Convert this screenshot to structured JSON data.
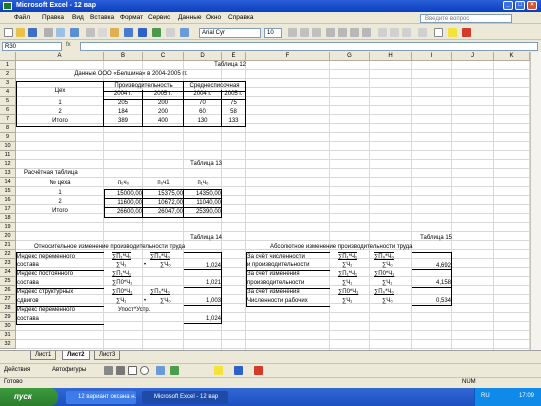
{
  "window": {
    "title": "Microsoft Excel - 12 вар"
  },
  "menu": [
    "Файл",
    "Правка",
    "Вид",
    "Вставка",
    "Формат",
    "Сервис",
    "Данные",
    "Окно",
    "Справка"
  ],
  "help_placeholder": "Введите вопрос",
  "toolbar": {
    "font": "Arial Cyr",
    "size": "10"
  },
  "namebox": "R30",
  "fx": "fx",
  "columns": [
    "A",
    "B",
    "C",
    "D",
    "E",
    "F",
    "G",
    "H",
    "I",
    "J",
    "K"
  ],
  "rows": [
    "1",
    "2",
    "3",
    "4",
    "5",
    "6",
    "7",
    "8",
    "9",
    "10",
    "11",
    "12",
    "13",
    "14",
    "15",
    "16",
    "17",
    "18",
    "19",
    "20",
    "21",
    "22",
    "23",
    "24",
    "25",
    "26",
    "27",
    "28",
    "29",
    "30",
    "31",
    "32"
  ],
  "t12": {
    "label": "Таблица 12",
    "title": "Данные ООО «Белшина» в 2004-2005 гг.",
    "h_shop": "Цех",
    "h_prod": "Производительность",
    "h_avg": "Среднесписочная",
    "y2004": "2004 г.",
    "y2005": "2005 г.",
    "rows": [
      {
        "n": "1",
        "a": "205",
        "b": "200",
        "c": "70",
        "d": "75"
      },
      {
        "n": "2",
        "a": "184",
        "b": "200",
        "c": "60",
        "d": "58"
      },
      {
        "n": "Итого",
        "a": "389",
        "b": "400",
        "c": "130",
        "d": "133"
      }
    ]
  },
  "t13": {
    "label": "Таблица 13",
    "title": "Расчётная таблица",
    "h_shop": "№ цеха",
    "h1": "п₀ч₀",
    "h2": "п₀ч1",
    "h3": "п₁ч₀",
    "rows": [
      {
        "n": "1",
        "a": "15000,00",
        "b": "15375,00",
        "c": "14350,00"
      },
      {
        "n": "2",
        "a": "11600,00",
        "b": "10672,00",
        "c": "11040,00"
      },
      {
        "n": "Итого",
        "a": "26600,00",
        "b": "26047,00",
        "c": "25390,00"
      }
    ]
  },
  "t14": {
    "label": "Таблица 14",
    "title": "Относительное изменение производительности труда",
    "r1a": "Индекс переменного",
    "r1b": "состава",
    "r1f1": "∑П₁*Ч₁",
    "r1f2": "∑П₀*Ч₀",
    "r1f3": "∑Ч₁",
    "r1f4": "∑Ч₀",
    "r1v": "1,024",
    "r2a": "Индекс постоянного",
    "r2b": "состава",
    "r2f1": "∑П₁*Ч₁",
    "r2f2": "∑П0*Ч₁",
    "r2v": "1,021",
    "r3a": "Индекс структурных",
    "r3b": "сдвигов",
    "r3f1": "∑П0*Ч₁",
    "r3f2": "∑П₀*Ч₀",
    "r3f3": "∑Ч₁",
    "r3f4": "∑Ч₀",
    "r3v": "1,003",
    "r4a": "Индекс переменного",
    "r4b": "состава",
    "r4f": "Упост*Устр.",
    "r4v": "1,024",
    "bullet": "•"
  },
  "t15": {
    "label": "Таблица 15",
    "title": "Абсолютное изменение производительности труда",
    "r1a": "За счёт численности",
    "r1b": "и производительности",
    "r1f1": "∑П₁*Ч₁",
    "r1f2": "∑П₀*Ч₀",
    "r1f3": "∑Ч₁",
    "r1f4": "∑Ч₀",
    "r1v": "4,692",
    "r2a": "За счёт изменения",
    "r2b": "производительности",
    "r2f1": "∑П₁*Ч₁",
    "r2f2": "∑П0*Ч₁",
    "r2f3": "∑Ч₁",
    "r2f4": "∑Ч₁",
    "r2v": "4,158",
    "r3a": "За счёт изменения",
    "r3b": "Численности рабочих",
    "r3f1": "∑П0*Ч₁",
    "r3f2": "∑П₀*Ч₀",
    "r3f3": "∑Ч₁",
    "r3f4": "∑Ч₀",
    "r3v": "0,534"
  },
  "sheets": [
    "Лист1",
    "Лист2",
    "Лист3"
  ],
  "active_sheet": "Лист2",
  "drawbar": {
    "actions": "Действия",
    "autoshapes": "Автофигуры"
  },
  "status": {
    "left": "Готово",
    "right": "NUM"
  },
  "taskbar": {
    "start": "пуск",
    "task1": "12 вариант оксана н...",
    "task2": "Microsoft Excel - 12 вар",
    "lang": "RU",
    "time": "17:09"
  }
}
